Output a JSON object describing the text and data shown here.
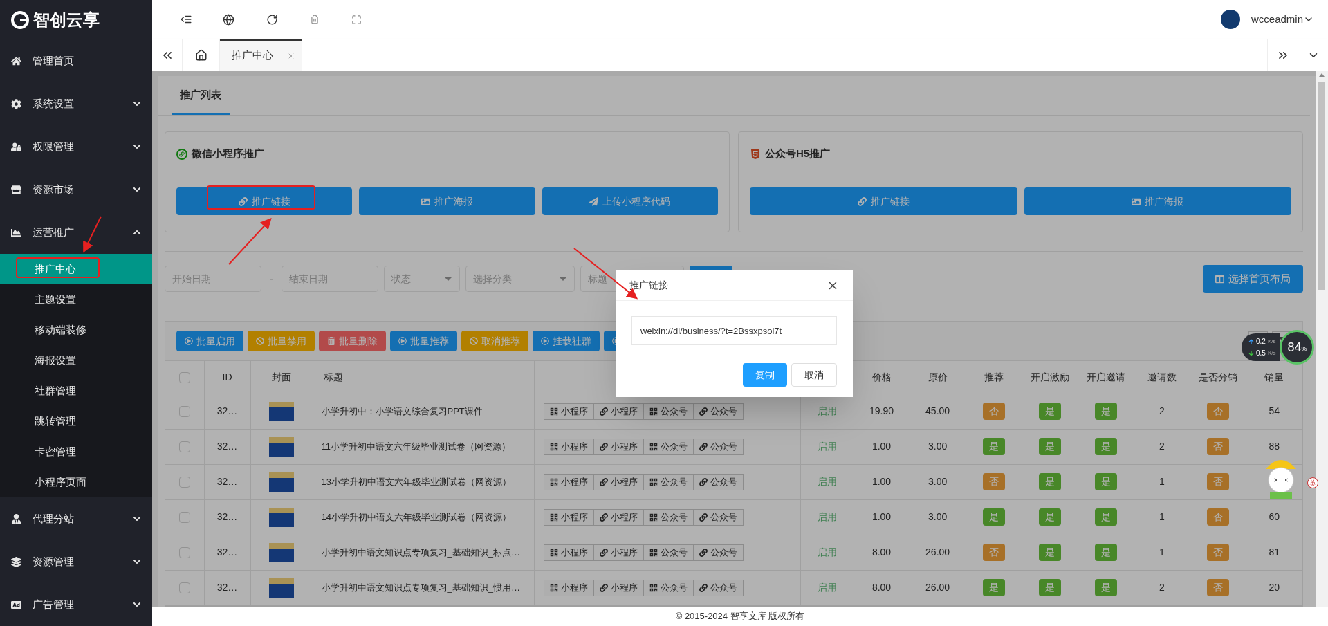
{
  "brand": {
    "name": "智创云享"
  },
  "sidebar": {
    "items": [
      {
        "label": "管理首页"
      },
      {
        "label": "系统设置",
        "expanded": false
      },
      {
        "label": "权限管理",
        "expanded": false
      },
      {
        "label": "资源市场",
        "expanded": false
      },
      {
        "label": "运营推广",
        "expanded": true,
        "children": [
          {
            "label": "推广中心",
            "selected": true
          },
          {
            "label": "主题设置",
            "selected": false
          },
          {
            "label": "移动端装修",
            "selected": false
          },
          {
            "label": "海报设置",
            "selected": false
          },
          {
            "label": "社群管理",
            "selected": false
          },
          {
            "label": "跳转管理",
            "selected": false
          },
          {
            "label": "卡密管理",
            "selected": false
          },
          {
            "label": "小程序页面",
            "selected": false
          }
        ]
      },
      {
        "label": "代理分站",
        "expanded": false
      },
      {
        "label": "资源管理",
        "expanded": false
      },
      {
        "label": "广告管理",
        "expanded": false
      }
    ]
  },
  "header": {
    "user": "wcceadmin"
  },
  "page_tabs": [
    {
      "label": "推广中心",
      "selected": true
    }
  ],
  "content_tabs": [
    {
      "label": "推广列表",
      "selected": true
    }
  ],
  "promo_cards": [
    {
      "title": "微信小程序推广",
      "kind": "mini",
      "buttons": [
        {
          "label": "推广链接",
          "kind": "link"
        },
        {
          "label": "推广海报",
          "kind": "image"
        },
        {
          "label": "上传小程序代码",
          "kind": "send"
        }
      ]
    },
    {
      "title": "公众号H5推广",
      "kind": "h5",
      "buttons": [
        {
          "label": "推广链接",
          "kind": "link"
        },
        {
          "label": "推广海报",
          "kind": "image"
        }
      ]
    }
  ],
  "filters": [
    {
      "kind": "input",
      "placeholder": "开始日期"
    },
    {
      "kind": "dash",
      "text": "-"
    },
    {
      "kind": "input",
      "placeholder": "结束日期"
    },
    {
      "kind": "select",
      "placeholder": "状态"
    },
    {
      "kind": "select",
      "placeholder": "选择分类"
    },
    {
      "kind": "input",
      "placeholder": "标题"
    },
    {
      "kind": "button"
    }
  ],
  "layout_button": {
    "label": "选择首页布局"
  },
  "toolbar": [
    {
      "label": "批量启用",
      "kind": "normal"
    },
    {
      "label": "批量禁用",
      "kind": "warm"
    },
    {
      "label": "批量删除",
      "kind": "danger"
    },
    {
      "label": "批量推荐",
      "kind": "normal"
    },
    {
      "label": "取消推荐",
      "kind": "warm"
    },
    {
      "label": "挂载社群",
      "kind": "normal"
    },
    {
      "kind": "normal"
    }
  ],
  "table": {
    "all_checked": false,
    "columns": [
      "ID",
      "封面",
      "标题",
      "价格",
      "原价",
      "推荐",
      "开启激励",
      "开启邀请",
      "邀请数",
      "是否分销",
      "销量"
    ],
    "rows": [
      {
        "checked": false,
        "id": "32…",
        "title": "小学升初中：小学语文综合复习PPT课件",
        "actions": [
          {
            "label": "小程序",
            "kind": "qrcode"
          },
          {
            "label": "小程序",
            "kind": "link"
          },
          {
            "label": "公众号",
            "kind": "qrcode"
          },
          {
            "label": "公众号",
            "kind": "link"
          }
        ],
        "status": "启用",
        "price": "19.90",
        "orig": "45.00",
        "recommend": {
          "text": "否",
          "on": false
        },
        "incentive": {
          "text": "是",
          "on": true
        },
        "invite": {
          "text": "是",
          "on": true
        },
        "invites": "2",
        "distribution": {
          "text": "否",
          "on": false
        },
        "sales": "54"
      },
      {
        "checked": false,
        "id": "32…",
        "title": "11小学升初中语文六年级毕业测试卷（网资源）",
        "actions": [
          {
            "label": "小程序",
            "kind": "qrcode"
          },
          {
            "label": "小程序",
            "kind": "link"
          },
          {
            "label": "公众号",
            "kind": "qrcode"
          },
          {
            "label": "公众号",
            "kind": "link"
          }
        ],
        "status": "启用",
        "price": "1.00",
        "orig": "3.00",
        "recommend": {
          "text": "是",
          "on": true
        },
        "incentive": {
          "text": "是",
          "on": true
        },
        "invite": {
          "text": "是",
          "on": true
        },
        "invites": "2",
        "distribution": {
          "text": "否",
          "on": false
        },
        "sales": "88"
      },
      {
        "checked": false,
        "id": "32…",
        "title": "13小学升初中语文六年级毕业测试卷（网资源）",
        "actions": [
          {
            "label": "小程序",
            "kind": "qrcode"
          },
          {
            "label": "小程序",
            "kind": "link"
          },
          {
            "label": "公众号",
            "kind": "qrcode"
          },
          {
            "label": "公众号",
            "kind": "link"
          }
        ],
        "status": "启用",
        "price": "1.00",
        "orig": "3.00",
        "recommend": {
          "text": "否",
          "on": false
        },
        "incentive": {
          "text": "是",
          "on": true
        },
        "invite": {
          "text": "是",
          "on": true
        },
        "invites": "1",
        "distribution": {
          "text": "否",
          "on": false
        },
        "sales": ""
      },
      {
        "checked": false,
        "id": "32…",
        "title": "14小学升初中语文六年级毕业测试卷（网资源）",
        "actions": [
          {
            "label": "小程序",
            "kind": "qrcode"
          },
          {
            "label": "小程序",
            "kind": "link"
          },
          {
            "label": "公众号",
            "kind": "qrcode"
          },
          {
            "label": "公众号",
            "kind": "link"
          }
        ],
        "status": "启用",
        "price": "1.00",
        "orig": "3.00",
        "recommend": {
          "text": "是",
          "on": true
        },
        "incentive": {
          "text": "是",
          "on": true
        },
        "invite": {
          "text": "是",
          "on": true
        },
        "invites": "1",
        "distribution": {
          "text": "否",
          "on": false
        },
        "sales": "60"
      },
      {
        "checked": false,
        "id": "32…",
        "title": "小学升初中语文知识点专项复习_基础知识_标点…",
        "actions": [
          {
            "label": "小程序",
            "kind": "qrcode"
          },
          {
            "label": "小程序",
            "kind": "link"
          },
          {
            "label": "公众号",
            "kind": "qrcode"
          },
          {
            "label": "公众号",
            "kind": "link"
          }
        ],
        "status": "启用",
        "price": "8.00",
        "orig": "26.00",
        "recommend": {
          "text": "否",
          "on": false
        },
        "incentive": {
          "text": "是",
          "on": true
        },
        "invite": {
          "text": "是",
          "on": true
        },
        "invites": "1",
        "distribution": {
          "text": "否",
          "on": false
        },
        "sales": "81"
      },
      {
        "checked": false,
        "id": "32…",
        "title": "小学升初中语文知识点专项复习_基础知识_惯用…",
        "actions": [
          {
            "label": "小程序",
            "kind": "qrcode"
          },
          {
            "label": "小程序",
            "kind": "link"
          },
          {
            "label": "公众号",
            "kind": "qrcode"
          },
          {
            "label": "公众号",
            "kind": "link"
          }
        ],
        "status": "启用",
        "price": "8.00",
        "orig": "26.00",
        "recommend": {
          "text": "是",
          "on": true
        },
        "incentive": {
          "text": "是",
          "on": true
        },
        "invite": {
          "text": "是",
          "on": true
        },
        "invites": "2",
        "distribution": {
          "text": "否",
          "on": false
        },
        "sales": "20"
      }
    ]
  },
  "dialog": {
    "title": "推广链接",
    "value": "weixin://dl/business/?t=2Bssxpsol7t",
    "buttons": [
      {
        "label": "复制",
        "kind": "primary"
      },
      {
        "label": "取消",
        "kind": "default"
      }
    ]
  },
  "speed_widget": {
    "up": "0.2",
    "up_unit": "K/s",
    "down": "0.5",
    "down_unit": "K/s",
    "percent": "84",
    "percent_unit": "%"
  },
  "ime_indicator": "英",
  "footer": "© 2015-2024 智享文库 版权所有"
}
